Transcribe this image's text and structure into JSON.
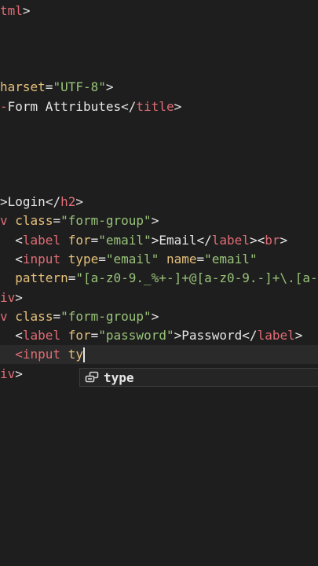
{
  "colors": {
    "background": "#1e1e1e",
    "tag": "#e06c75",
    "attr": "#e5c07b",
    "string": "#98c379",
    "text": "#e6e6e6"
  },
  "lines": [
    {
      "tokens": [
        {
          "t": "tml",
          "c": "tag"
        },
        {
          "t": ">",
          "c": "text"
        }
      ]
    },
    {
      "tokens": []
    },
    {
      "tokens": []
    },
    {
      "tokens": []
    },
    {
      "tokens": [
        {
          "t": "harset",
          "c": "attr"
        },
        {
          "t": "=",
          "c": "text"
        },
        {
          "t": "\"UTF-8\"",
          "c": "string"
        },
        {
          "t": ">",
          "c": "text"
        }
      ]
    },
    {
      "tokens": [
        {
          "t": "-",
          "c": "tag"
        },
        {
          "t": "Form Attributes",
          "c": "text"
        },
        {
          "t": "</",
          "c": "text"
        },
        {
          "t": "title",
          "c": "tag"
        },
        {
          "t": ">",
          "c": "text"
        }
      ]
    },
    {
      "tokens": []
    },
    {
      "tokens": []
    },
    {
      "tokens": []
    },
    {
      "tokens": []
    },
    {
      "tokens": [
        {
          "t": "",
          ">": 1,
          "c": "tag"
        },
        {
          "t": ">",
          "c": "text"
        },
        {
          "t": "Login",
          "c": "text"
        },
        {
          "t": "</",
          "c": "text"
        },
        {
          "t": "h2",
          "c": "tag"
        },
        {
          "t": ">",
          "c": "text"
        }
      ]
    },
    {
      "tokens": [
        {
          "t": "v",
          "c": "tag"
        },
        {
          "t": " ",
          "c": "text"
        },
        {
          "t": "class",
          "c": "attr"
        },
        {
          "t": "=",
          "c": "text"
        },
        {
          "t": "\"form-group\"",
          "c": "string"
        },
        {
          "t": ">",
          "c": "text"
        }
      ]
    },
    {
      "tokens": [
        {
          "t": "  <",
          "c": "text"
        },
        {
          "t": "label",
          "c": "tag"
        },
        {
          "t": " ",
          "c": "text"
        },
        {
          "t": "for",
          "c": "attr"
        },
        {
          "t": "=",
          "c": "text"
        },
        {
          "t": "\"email\"",
          "c": "string"
        },
        {
          "t": ">",
          "c": "text"
        },
        {
          "t": "Email",
          "c": "text"
        },
        {
          "t": "</",
          "c": "text"
        },
        {
          "t": "label",
          "c": "tag"
        },
        {
          "t": "><",
          "c": "text"
        },
        {
          "t": "br",
          "c": "tag"
        },
        {
          "t": ">",
          "c": "text"
        }
      ]
    },
    {
      "tokens": [
        {
          "t": "  <",
          "c": "text"
        },
        {
          "t": "input",
          "c": "tag"
        },
        {
          "t": " ",
          "c": "text"
        },
        {
          "t": "type",
          "c": "attr"
        },
        {
          "t": "=",
          "c": "text"
        },
        {
          "t": "\"email\"",
          "c": "string"
        },
        {
          "t": " ",
          "c": "text"
        },
        {
          "t": "name",
          "c": "attr"
        },
        {
          "t": "=",
          "c": "text"
        },
        {
          "t": "\"email\"",
          "c": "string"
        }
      ]
    },
    {
      "tokens": [
        {
          "t": "  ",
          "c": "text"
        },
        {
          "t": "pattern",
          "c": "attr"
        },
        {
          "t": "=",
          "c": "text"
        },
        {
          "t": "\"[a-z0-9._%+-]+@[a-z0-9.-]+\\.[a-",
          "c": "string"
        }
      ]
    },
    {
      "tokens": [
        {
          "t": "iv",
          "c": "tag"
        },
        {
          "t": ">",
          "c": "text"
        }
      ]
    },
    {
      "tokens": [
        {
          "t": "v",
          "c": "tag"
        },
        {
          "t": " ",
          "c": "text"
        },
        {
          "t": "class",
          "c": "attr"
        },
        {
          "t": "=",
          "c": "text"
        },
        {
          "t": "\"form-group\"",
          "c": "string"
        },
        {
          "t": ">",
          "c": "text"
        }
      ]
    },
    {
      "tokens": [
        {
          "t": "  <",
          "c": "text"
        },
        {
          "t": "label",
          "c": "tag"
        },
        {
          "t": " ",
          "c": "text"
        },
        {
          "t": "for",
          "c": "attr"
        },
        {
          "t": "=",
          "c": "text"
        },
        {
          "t": "\"password\"",
          "c": "string"
        },
        {
          "t": ">",
          "c": "text"
        },
        {
          "t": "Password",
          "c": "text"
        },
        {
          "t": "</",
          "c": "text"
        },
        {
          "t": "label",
          "c": "tag"
        },
        {
          "t": ">",
          "c": "text"
        }
      ]
    },
    {
      "tokens": [
        {
          "t": "  ",
          "c": "text"
        },
        {
          "t": "<input",
          "c": "tag"
        },
        {
          "t": " ",
          "c": "text"
        },
        {
          "t": "ty",
          "c": "attr"
        }
      ],
      "current": true
    },
    {
      "tokens": [
        {
          "t": "iv",
          "c": "tag"
        },
        {
          "t": ">",
          "c": "text"
        }
      ]
    }
  ],
  "suggestion": {
    "label": "type",
    "icon": "property-icon"
  }
}
